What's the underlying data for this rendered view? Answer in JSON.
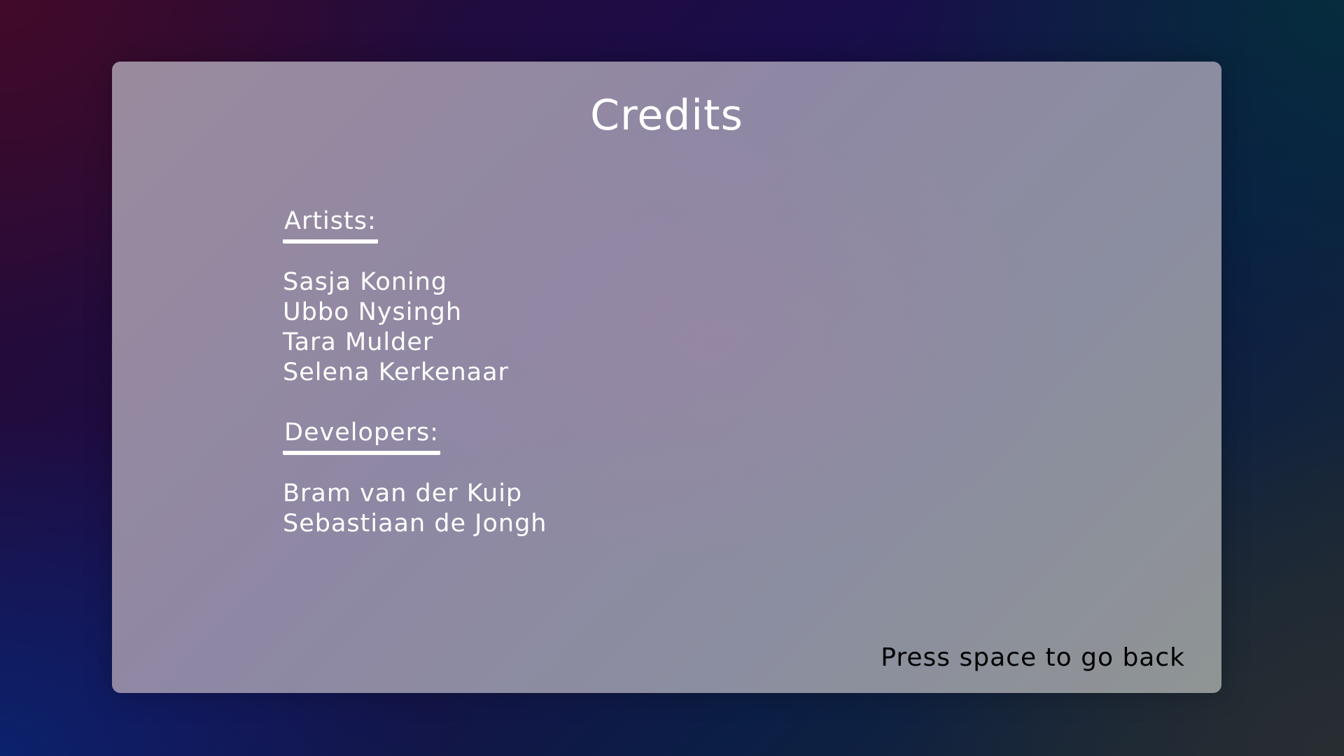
{
  "credits": {
    "title": "Credits",
    "artists": {
      "heading": "Artists:",
      "names": [
        "Sasja Koning",
        "Ubbo Nysingh",
        "Tara Mulder",
        "Selena Kerkenaar"
      ]
    },
    "developers": {
      "heading": "Developers:",
      "names": [
        "Bram van der Kuip",
        "Sebastiaan de Jongh"
      ]
    },
    "back_hint": "Press space to go back"
  },
  "colors": {
    "panel_text": "#ffffff",
    "hint_text": "#000000"
  }
}
